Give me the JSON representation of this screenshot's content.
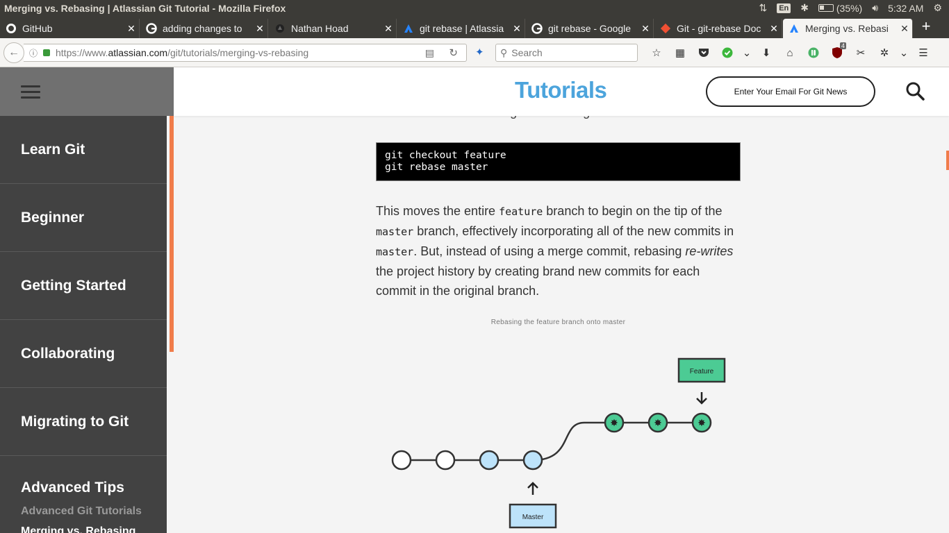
{
  "os": {
    "window_title": "Merging vs. Rebasing | Atlassian Git Tutorial - Mozilla Firefox",
    "keyboard": "En",
    "battery": "(35%)",
    "time": "5:32 AM"
  },
  "tabs": [
    {
      "label": "GitHub",
      "icon": "github-icon"
    },
    {
      "label": "adding changes to",
      "icon": "google-icon"
    },
    {
      "label": "Nathan Hoad",
      "icon": "site-icon"
    },
    {
      "label": "git rebase | Atlassia",
      "icon": "atlassian-icon"
    },
    {
      "label": "git rebase - Google",
      "icon": "google-icon"
    },
    {
      "label": "Git - git-rebase Doc",
      "icon": "git-icon"
    },
    {
      "label": "Merging vs. Rebasi",
      "icon": "atlassian-icon",
      "active": true
    }
  ],
  "navbar": {
    "url_prefix": "https://www.",
    "url_host": "atlassian.com",
    "url_path": "/git/tutorials/merging-vs-rebasing",
    "search_placeholder": "Search",
    "ublock_badge": "4"
  },
  "sidebar": {
    "items": [
      "Learn Git",
      "Beginner",
      "Getting Started",
      "Collaborating",
      "Migrating to Git",
      "Advanced Tips"
    ],
    "sub_items": [
      "Advanced Git Tutorials",
      "Merging vs. Rebasing"
    ]
  },
  "header": {
    "brand": "Tutorials",
    "email_button": "Enter Your Email For Git News"
  },
  "article": {
    "clipped_line": "onto master branch using the following commands:",
    "code": "git checkout feature\ngit rebase master",
    "para_1": "This moves the entire ",
    "code_feature": "feature",
    "para_2": " branch to begin on the tip of the ",
    "code_master_1": "master",
    "para_3": " branch, effectively incorporating all of the new commits in ",
    "code_master_2": "master",
    "para_4": ". But, instead of using a merge commit, rebasing ",
    "para_em": "re-writes",
    "para_5": " the project history by creating brand new commits for each commit in the original branch.",
    "figure_caption": "Rebasing the feature branch onto master",
    "diagram": {
      "feature_label": "Feature",
      "master_label": "Master"
    }
  },
  "colors": {
    "brand_blue": "#4ca4dc",
    "accent_orange": "#f07c4a",
    "commit_blue": "#bde3fa",
    "commit_green": "#4ccb94"
  }
}
